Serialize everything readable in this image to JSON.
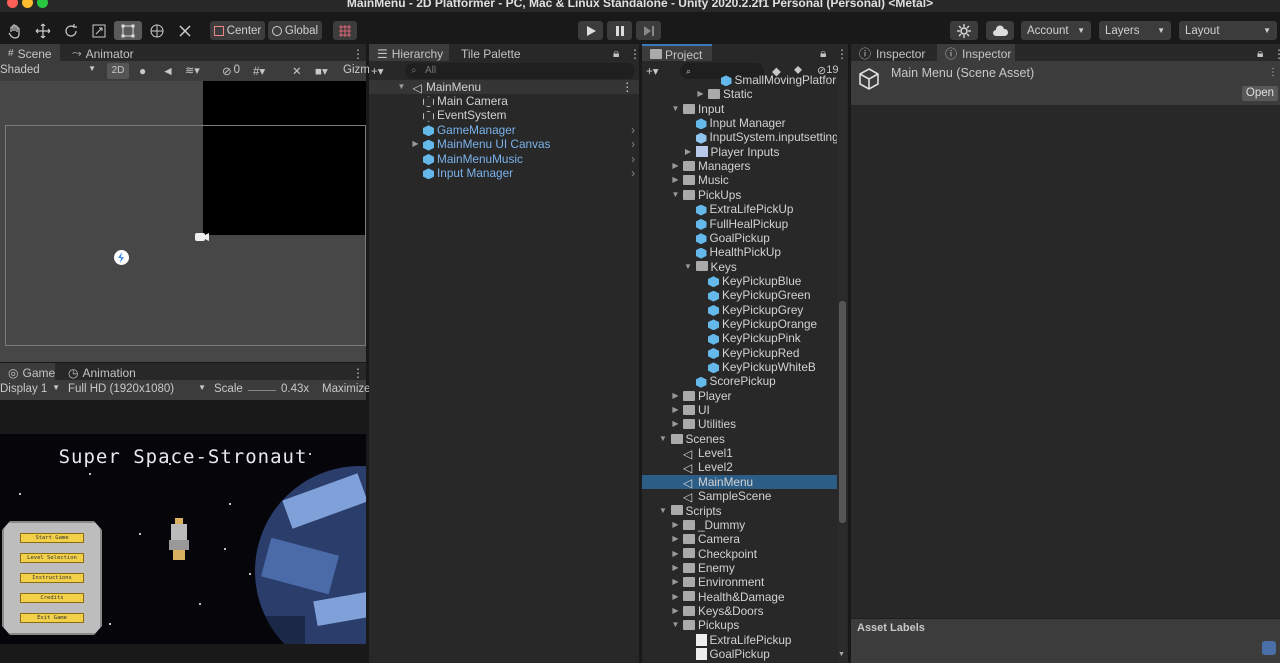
{
  "window": {
    "title": "MainMenu - 2D Platformer - PC, Mac & Linux Standalone - Unity 2020.2.2f1 Personal (Personal) <Metal>"
  },
  "toolbar": {
    "center_label": "Center",
    "global_label": "Global",
    "account_label": "Account",
    "layers_label": "Layers",
    "layout_label": "Layout"
  },
  "scene_panel": {
    "tab_scene": "Scene",
    "tab_animator": "Animator",
    "shading_mode": "Shaded",
    "mode_2d": "2D",
    "hidden_count": "0",
    "gizmos_label": "Gizm"
  },
  "game_panel": {
    "tab_game": "Game",
    "tab_animation": "Animation",
    "display": "Display 1",
    "resolution": "Full HD (1920x1080)",
    "scale_label": "Scale",
    "scale_value": "0.43x",
    "maximize_label": "Maximize",
    "game_title": "Super Space-Stronaut",
    "menu_buttons": [
      "Start Game",
      "Level Selection",
      "Instructions",
      "Credits",
      "Exit Game"
    ]
  },
  "hierarchy": {
    "tab_hierarchy": "Hierarchy",
    "tab_tile_palette": "Tile Palette",
    "search_placeholder": "All",
    "scene_name": "MainMenu",
    "items": [
      {
        "label": "Main Camera",
        "prefab": false
      },
      {
        "label": "EventSystem",
        "prefab": false
      },
      {
        "label": "GameManager",
        "prefab": true
      },
      {
        "label": "MainMenu UI Canvas",
        "prefab": true
      },
      {
        "label": "MainMenuMusic",
        "prefab": true
      },
      {
        "label": "Input Manager",
        "prefab": true
      }
    ]
  },
  "project": {
    "tab_project": "Project",
    "hidden_count": "19",
    "items": [
      {
        "label": "SmallMovingPlatforn",
        "icon": "prefab"
      },
      {
        "label": "Static",
        "icon": "folder"
      },
      {
        "label": "Input",
        "icon": "folder"
      },
      {
        "label": "Input Manager",
        "icon": "prefab"
      },
      {
        "label": "InputSystem.inputsettings",
        "icon": "asset"
      },
      {
        "label": "Player Inputs",
        "icon": "input-actions"
      },
      {
        "label": "Managers",
        "icon": "folder"
      },
      {
        "label": "Music",
        "icon": "folder"
      },
      {
        "label": "PickUps",
        "icon": "folder"
      },
      {
        "label": "ExtraLifePickUp",
        "icon": "prefab"
      },
      {
        "label": "FullHealPickup",
        "icon": "prefab"
      },
      {
        "label": "GoalPickup",
        "icon": "prefab"
      },
      {
        "label": "HealthPickUp",
        "icon": "prefab"
      },
      {
        "label": "Keys",
        "icon": "folder"
      },
      {
        "label": "KeyPickupBlue",
        "icon": "prefab"
      },
      {
        "label": "KeyPickupGreen",
        "icon": "prefab"
      },
      {
        "label": "KeyPickupGrey",
        "icon": "prefab"
      },
      {
        "label": "KeyPickupOrange",
        "icon": "prefab"
      },
      {
        "label": "KeyPickupPink",
        "icon": "prefab"
      },
      {
        "label": "KeyPickupRed",
        "icon": "prefab"
      },
      {
        "label": "KeyPickupWhiteB",
        "icon": "prefab"
      },
      {
        "label": "ScorePickup",
        "icon": "prefab"
      },
      {
        "label": "Player",
        "icon": "folder"
      },
      {
        "label": "UI",
        "icon": "folder"
      },
      {
        "label": "Utilities",
        "icon": "folder"
      },
      {
        "label": "Scenes",
        "icon": "folder"
      },
      {
        "label": "Level1",
        "icon": "scene"
      },
      {
        "label": "Level2",
        "icon": "scene"
      },
      {
        "label": "MainMenu",
        "icon": "scene"
      },
      {
        "label": "SampleScene",
        "icon": "scene"
      },
      {
        "label": "Scripts",
        "icon": "folder"
      },
      {
        "label": "_Dummy",
        "icon": "folder"
      },
      {
        "label": "Camera",
        "icon": "folder"
      },
      {
        "label": "Checkpoint",
        "icon": "folder"
      },
      {
        "label": "Enemy",
        "icon": "folder"
      },
      {
        "label": "Environment",
        "icon": "folder"
      },
      {
        "label": "Health&Damage",
        "icon": "folder"
      },
      {
        "label": "Keys&Doors",
        "icon": "folder"
      },
      {
        "label": "Pickups",
        "icon": "folder"
      },
      {
        "label": "ExtraLifePickup",
        "icon": "script"
      },
      {
        "label": "GoalPickup",
        "icon": "script"
      }
    ]
  },
  "inspector": {
    "tab_1": "Inspector",
    "tab_2": "Inspector",
    "asset_title": "Main Menu (Scene Asset)",
    "open_label": "Open",
    "asset_labels": "Asset Labels"
  },
  "colors": {
    "accent": "#3a79bb",
    "selection": "#2c5d87",
    "prefab_blue": "#64b8ea",
    "prefab_text": "#7bb3ec"
  }
}
